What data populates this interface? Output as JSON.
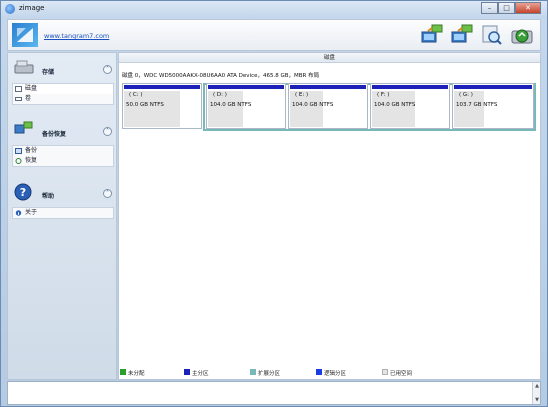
{
  "window": {
    "title": "zimage"
  },
  "header": {
    "site_link": "www.tangram7.com"
  },
  "sidebar": {
    "storage": {
      "title": "存储",
      "items": [
        {
          "label": "磁盘"
        },
        {
          "label": "卷"
        }
      ]
    },
    "backup": {
      "title": "备份恢复",
      "items": [
        {
          "label": "备份"
        },
        {
          "label": "恢复"
        }
      ]
    },
    "help": {
      "title": "帮助",
      "items": [
        {
          "label": "关于"
        }
      ]
    }
  },
  "main": {
    "title": "磁盘",
    "disk_info": "磁盘 0，WDC WD5000AAKX-08U6AA0 ATA Device，465.8 GB，MBR 布局",
    "partitions": [
      {
        "letter": "( C: )",
        "info": "50.0 GB NTFS",
        "used_fraction": 0.72
      },
      {
        "letter": "( D: )",
        "info": "104.0 GB NTFS",
        "used_fraction": 0.45
      },
      {
        "letter": "( E: )",
        "info": "104.0 GB NTFS",
        "used_fraction": 0.42
      },
      {
        "letter": "( F: )",
        "info": "104.0 GB NTFS",
        "used_fraction": 0.55
      },
      {
        "letter": "( G: )",
        "info": "103.7 GB NTFS",
        "used_fraction": 0.38
      }
    ],
    "legend": [
      {
        "label": "未分配",
        "color": "#2aa02a"
      },
      {
        "label": "主分区",
        "color": "#1c22b8"
      },
      {
        "label": "扩展分区",
        "color": "#79b8b8"
      },
      {
        "label": "逻辑分区",
        "color": "#1a3ce0"
      },
      {
        "label": "已用空间",
        "color": "#e4e4e4"
      }
    ]
  }
}
